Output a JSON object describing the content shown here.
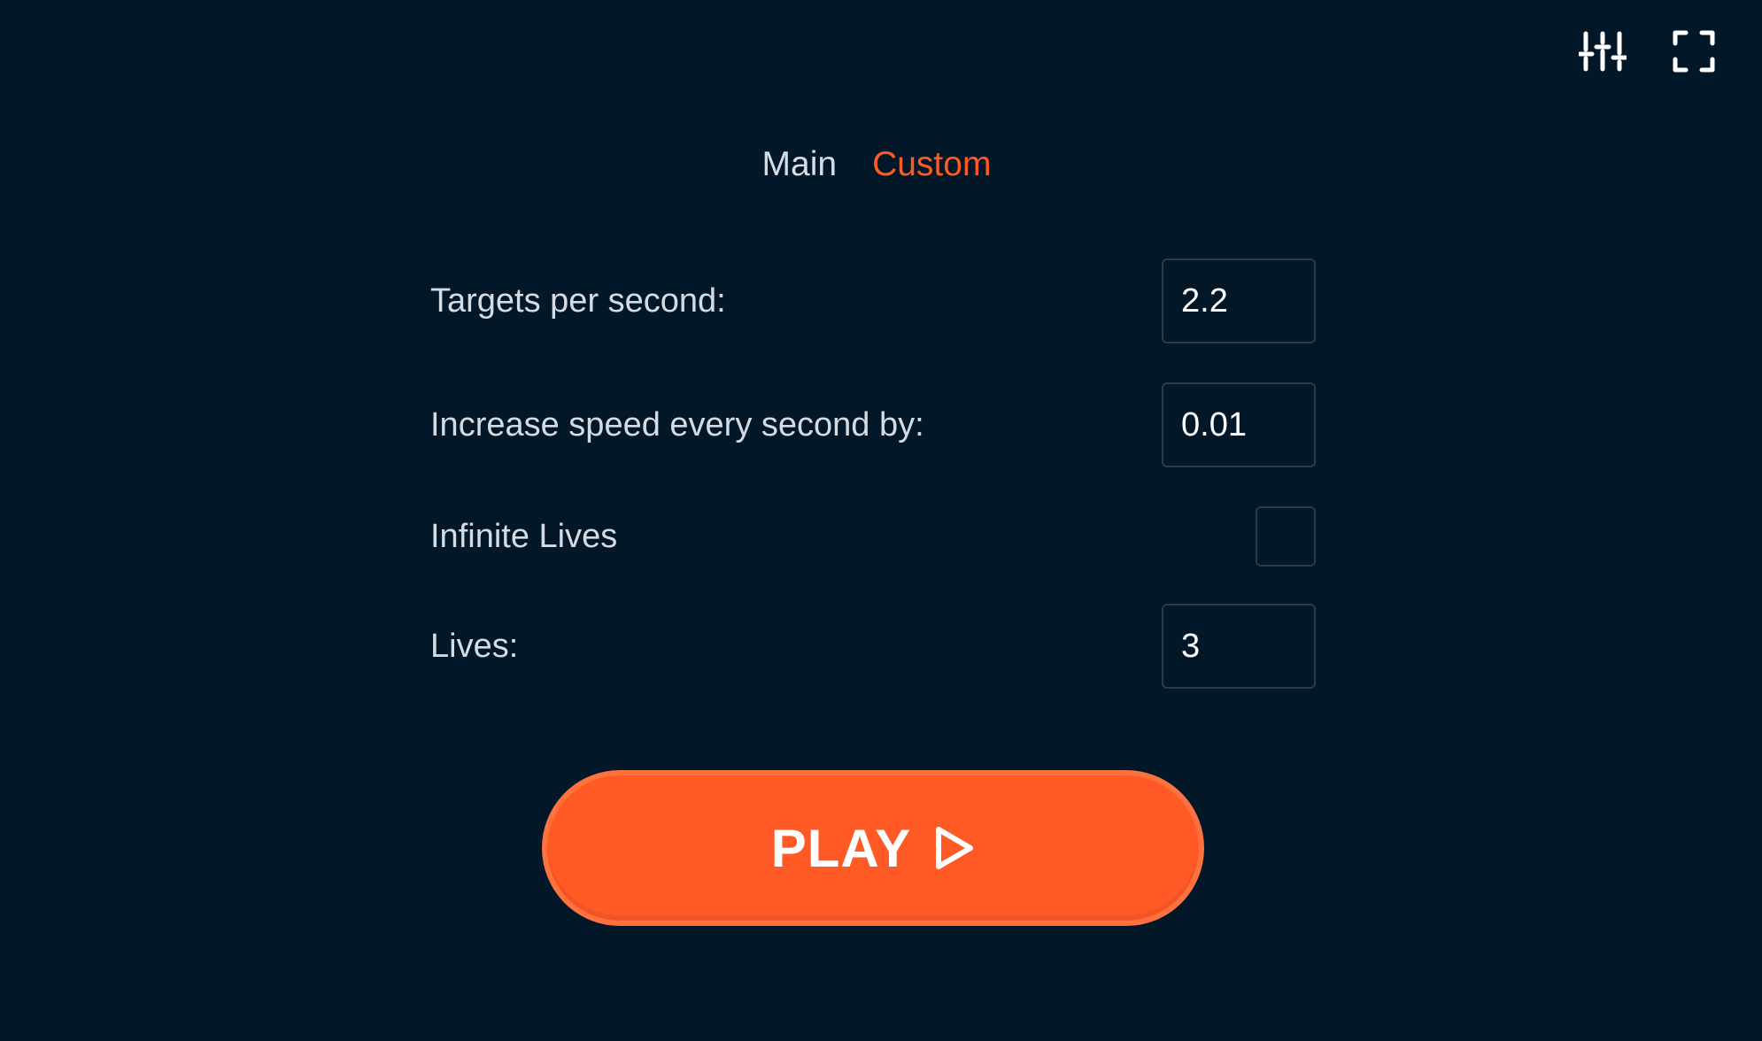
{
  "toolbar": {
    "settings_icon": "sliders-icon",
    "fullscreen_icon": "fullscreen-icon"
  },
  "tabs": [
    {
      "label": "Main",
      "active": false
    },
    {
      "label": "Custom",
      "active": true
    }
  ],
  "settings": {
    "targets_per_second": {
      "label": "Targets per second:",
      "value": "2.2"
    },
    "speed_increase": {
      "label": "Increase speed every second by:",
      "value": "0.01"
    },
    "infinite_lives": {
      "label": "Infinite Lives",
      "checked": false
    },
    "lives": {
      "label": "Lives:",
      "value": "3"
    }
  },
  "play": {
    "label": "PLAY",
    "icon": "play-triangle-icon"
  },
  "colors": {
    "background": "#021727",
    "accent": "#ff5a25",
    "text": "#d4dbe3",
    "input_border": "#2a3c4c"
  }
}
